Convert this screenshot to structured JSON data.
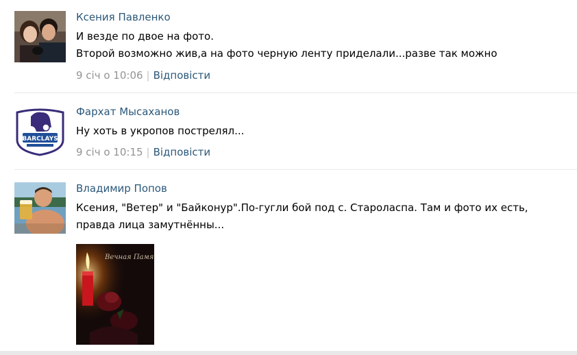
{
  "comments": [
    {
      "author": "Ксения Павленко",
      "avatar_icon": "couple-photo-avatar",
      "lines": [
        "И везде по двое на фото.",
        "Второй возможно жив,а на фото черную ленту приделали...разве так можно"
      ],
      "date": "9 січ о 10:06",
      "reply_label": "Відповісти"
    },
    {
      "author": "Фархат Мысаханов",
      "avatar_icon": "premier-league-lion-logo",
      "avatar_logo_text": "BARCLAYS",
      "lines": [
        "Ну хоть в укропов пострелял..."
      ],
      "date": "9 січ о 10:15",
      "reply_label": "Відповісти"
    },
    {
      "author": "Владимир Попов",
      "avatar_icon": "man-with-beer-avatar",
      "text": "Ксения, \"Ветер\" и \"Байконур\".По-гугли бой под с. Староласпа. Там и фото их есть, правда лица замутнённы...",
      "attachment": {
        "icon": "memorial-candle-image",
        "caption": "Вечная Память..."
      }
    }
  ],
  "colors": {
    "link": "#2b587a",
    "meta": "#939393",
    "divider": "#e7e8ec"
  }
}
